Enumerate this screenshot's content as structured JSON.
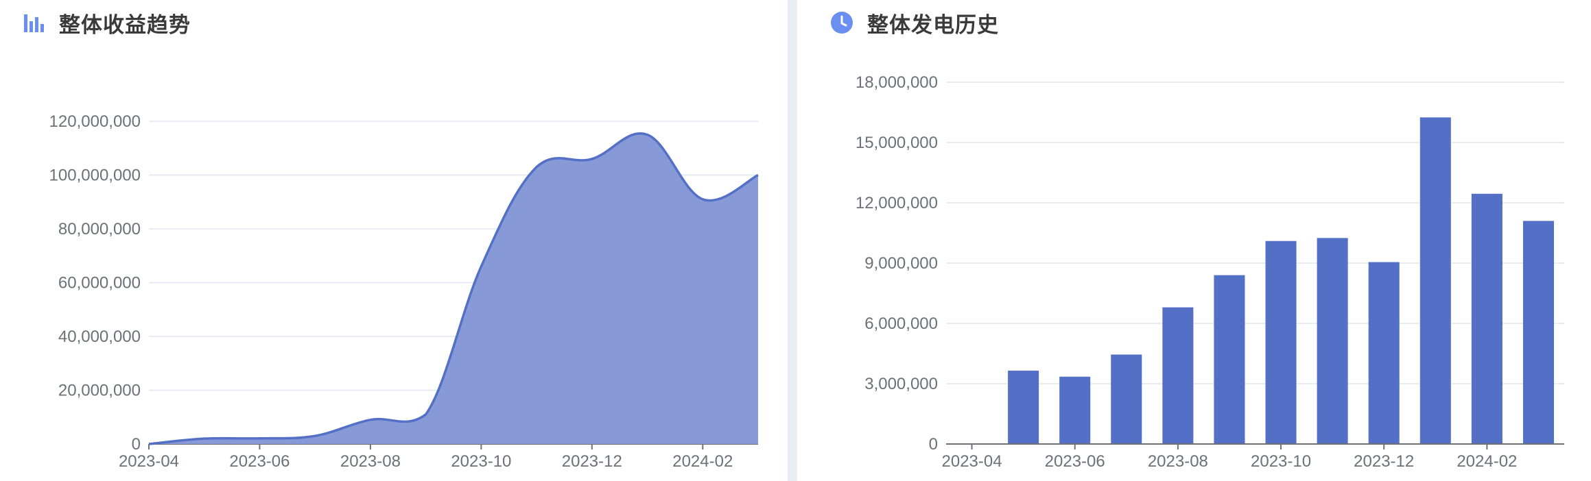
{
  "left_panel": {
    "title": "整体收益趋势",
    "icon": "bar-chart-icon"
  },
  "right_panel": {
    "title": "整体发电历史",
    "icon": "clock-icon"
  },
  "colors": {
    "accent": "#5470c6",
    "area_fill": "#8799d7",
    "icon_blue": "#6b8ff0",
    "grid": "#e0e6f1",
    "axis": "#6e7079",
    "divider": "#e8edf3",
    "title": "#3a3a3a"
  },
  "chart_data": [
    {
      "type": "area",
      "title": "整体收益趋势",
      "xlabel": "",
      "ylabel": "",
      "x": [
        "2023-04",
        "2023-05",
        "2023-06",
        "2023-07",
        "2023-08",
        "2023-09",
        "2023-10",
        "2023-11",
        "2023-12",
        "2024-01",
        "2024-02",
        "2024-03"
      ],
      "x_tick_labels": [
        "2023-04",
        "2023-06",
        "2023-08",
        "2023-10",
        "2023-12",
        "2024-02"
      ],
      "values": [
        0,
        2000000,
        2100000,
        3000000,
        9000000,
        11000000,
        66000000,
        103000000,
        106000000,
        115000000,
        91000000,
        100000000
      ],
      "ylim": [
        0,
        120000000
      ],
      "y_tick_labels": [
        "0",
        "20,000,000",
        "40,000,000",
        "60,000,000",
        "80,000,000",
        "100,000,000",
        "120,000,000"
      ],
      "grid": true,
      "smooth": true
    },
    {
      "type": "bar",
      "title": "整体发电历史",
      "xlabel": "",
      "ylabel": "",
      "categories": [
        "2023-04",
        "2023-05",
        "2023-06",
        "2023-07",
        "2023-08",
        "2023-09",
        "2023-10",
        "2023-11",
        "2023-12",
        "2024-01",
        "2024-02",
        "2024-03"
      ],
      "x_tick_labels": [
        "2023-04",
        "2023-06",
        "2023-08",
        "2023-10",
        "2023-12",
        "2024-02"
      ],
      "values": [
        0,
        3650000,
        3350000,
        4450000,
        6800000,
        8400000,
        10100000,
        10250000,
        9050000,
        16250000,
        12450000,
        11100000
      ],
      "ylim": [
        0,
        18000000
      ],
      "y_tick_labels": [
        "0",
        "3,000,000",
        "6,000,000",
        "9,000,000",
        "12,000,000",
        "15,000,000",
        "18,000,000"
      ],
      "grid": true
    }
  ]
}
